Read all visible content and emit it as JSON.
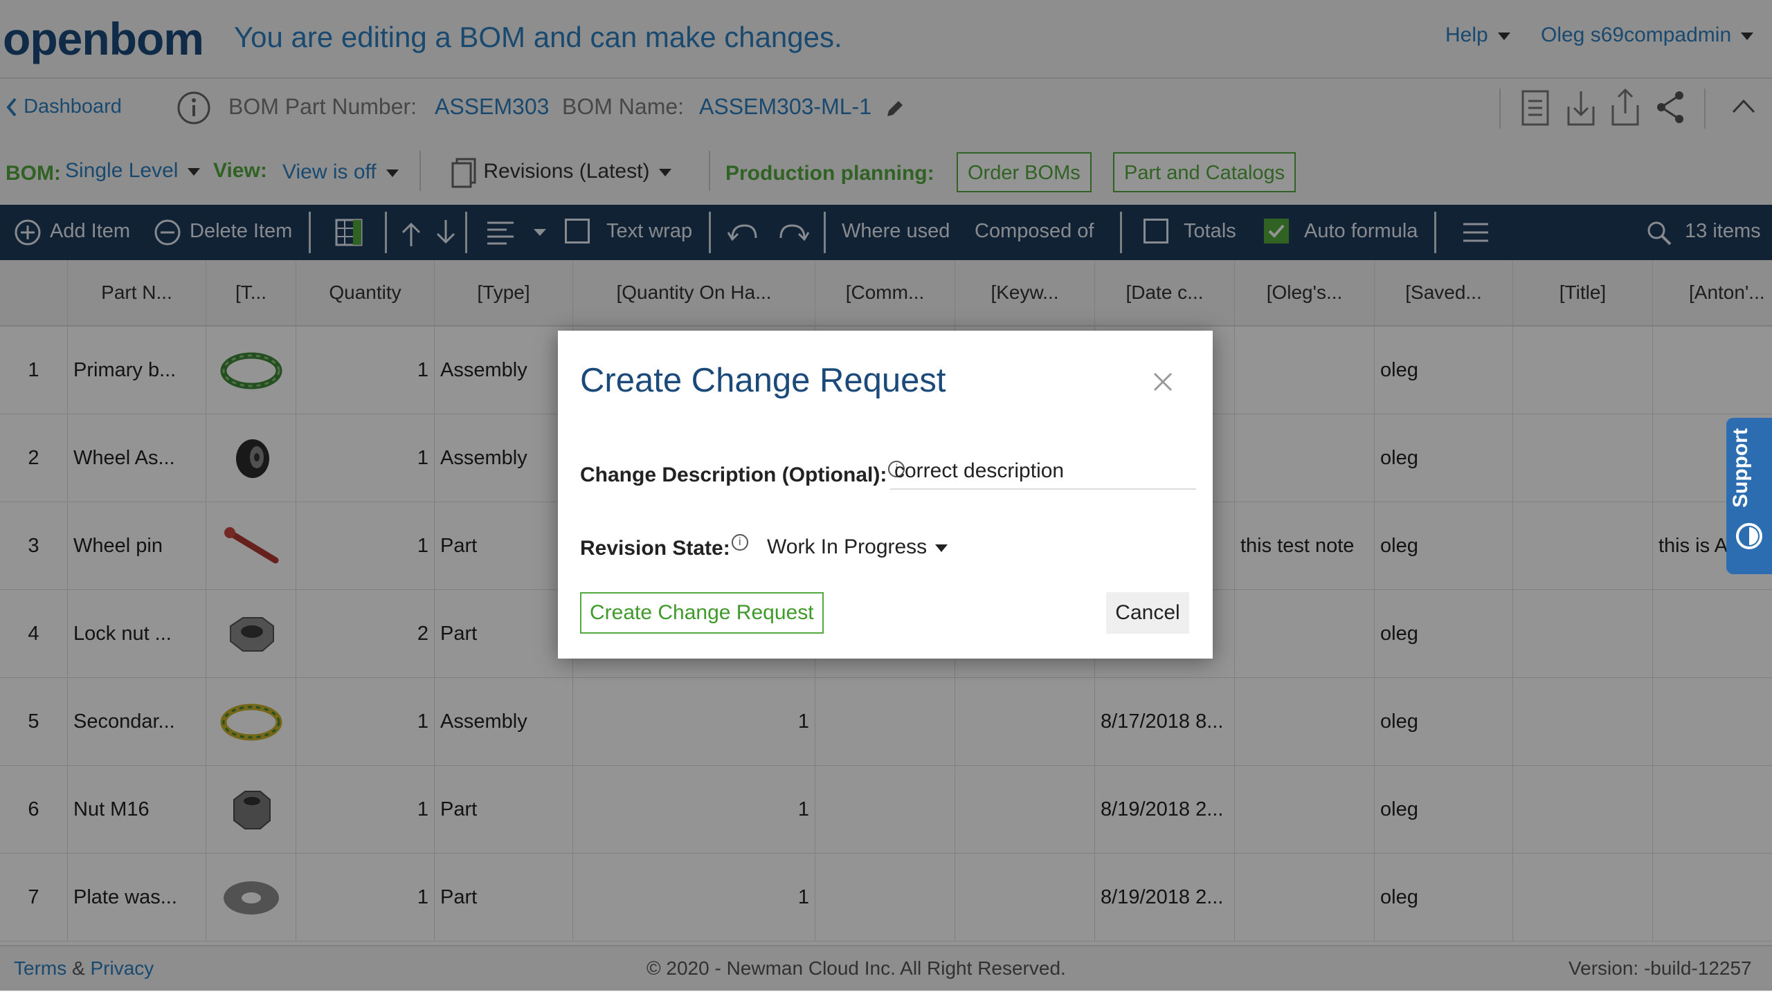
{
  "header": {
    "logo": "openbom",
    "edit_message": "You are editing a BOM and can make changes.",
    "help": "Help",
    "user": "Oleg s69compadmin"
  },
  "breadcrumb": {
    "back": "Dashboard",
    "part_number_label": "BOM Part Number:",
    "part_number": "ASSEM303",
    "name_label": "BOM Name:",
    "name": "ASSEM303-ML-1"
  },
  "bombar": {
    "bom_label": "BOM:",
    "bom_value": "Single Level",
    "view_label": "View:",
    "view_value": "View is off",
    "revisions": "Revisions (Latest)",
    "production_label": "Production planning:",
    "order_boms": "Order BOMs",
    "part_catalogs": "Part and Catalogs"
  },
  "toolbar": {
    "add_item": "Add Item",
    "delete_item": "Delete Item",
    "text_wrap": "Text wrap",
    "where_used": "Where used",
    "composed_of": "Composed of",
    "totals": "Totals",
    "auto_formula": "Auto formula",
    "items_count": "13 items"
  },
  "grid": {
    "columns": [
      "Part N...",
      "[T...",
      "Quantity",
      "[Type]",
      "[Quantity On Ha...",
      "[Comm...",
      "[Keyw...",
      "[Date c...",
      "[Oleg's...",
      "[Saved...",
      "[Title]",
      "[Anton'..."
    ],
    "rows": [
      {
        "n": "1",
        "part": "Primary b...",
        "thumb": "ring-green",
        "qty": "1",
        "type": "Assembly",
        "onhand": "",
        "date": "..",
        "oleg": "",
        "saved": "oleg",
        "anton": ""
      },
      {
        "n": "2",
        "part": "Wheel As...",
        "thumb": "wheel",
        "qty": "1",
        "type": "Assembly",
        "onhand": "",
        "date": "..",
        "oleg": "",
        "saved": "oleg",
        "anton": ""
      },
      {
        "n": "3",
        "part": "Wheel pin",
        "thumb": "pin",
        "qty": "1",
        "type": "Part",
        "onhand": "",
        "date": "..",
        "oleg": "this test note",
        "saved": "oleg",
        "anton": "this is A"
      },
      {
        "n": "4",
        "part": "Lock nut ...",
        "thumb": "locknut",
        "qty": "2",
        "type": "Part",
        "onhand": "",
        "date": "..",
        "oleg": "",
        "saved": "oleg",
        "anton": ""
      },
      {
        "n": "5",
        "part": "Secondar...",
        "thumb": "ring-yellow",
        "qty": "1",
        "type": "Assembly",
        "onhand": "1",
        "date": "8/17/2018 8...",
        "oleg": "",
        "saved": "oleg",
        "anton": ""
      },
      {
        "n": "6",
        "part": "Nut M16",
        "thumb": "nut",
        "qty": "1",
        "type": "Part",
        "onhand": "1",
        "date": "8/19/2018 2...",
        "oleg": "",
        "saved": "oleg",
        "anton": ""
      },
      {
        "n": "7",
        "part": "Plate was...",
        "thumb": "washer",
        "qty": "1",
        "type": "Part",
        "onhand": "1",
        "date": "8/19/2018 2...",
        "oleg": "",
        "saved": "oleg",
        "anton": ""
      }
    ]
  },
  "dialog": {
    "title": "Create Change Request",
    "description_label": "Change Description (Optional):",
    "description_value": "correct description",
    "revision_label": "Revision State:",
    "revision_value": "Work In Progress",
    "submit": "Create Change Request",
    "cancel": "Cancel"
  },
  "support": "Support",
  "footer": {
    "terms": "Terms",
    "amp": "&",
    "privacy": "Privacy",
    "copyright": "© 2020 - Newman Cloud Inc. All Right Reserved.",
    "version": "Version: -build-12257"
  },
  "colors": {
    "brand_blue": "#1b4a7a",
    "link_blue": "#2b7fc0",
    "green": "#53a93f",
    "toolbar": "#1f3b5c"
  }
}
